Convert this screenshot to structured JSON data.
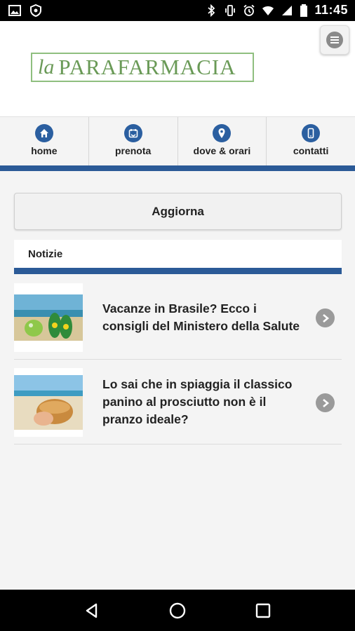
{
  "status_bar": {
    "time": "11:45",
    "left_icons": [
      "image-icon",
      "shield-icon"
    ],
    "right_icons": [
      "bluetooth-icon",
      "vibrate-icon",
      "alarm-icon",
      "wifi-icon",
      "signal-icon",
      "battery-icon"
    ]
  },
  "header": {
    "logo_prefix": "la",
    "logo_brand": "PARAFARMACIA",
    "menu_icon": "menu-icon"
  },
  "nav": {
    "items": [
      {
        "label": "home",
        "icon": "home-icon"
      },
      {
        "label": "prenota",
        "icon": "calendar-icon"
      },
      {
        "label": "dove & orari",
        "icon": "location-pin-icon"
      },
      {
        "label": "contatti",
        "icon": "phone-icon"
      }
    ]
  },
  "main": {
    "refresh_label": "Aggiorna",
    "section_title": "Notizie",
    "news": [
      {
        "title": "Vacanze in Brasile? Ecco i consigli del Ministero della Salute",
        "thumb": "beach-flipflops-thumbnail"
      },
      {
        "title": "Lo sai che in spiaggia il classico panino al prosciutto non è il pranzo ideale?",
        "thumb": "beach-sandwich-thumbnail"
      }
    ]
  },
  "system_nav": {
    "icons": [
      "back-icon",
      "home-circle-icon",
      "recents-icon"
    ]
  },
  "colors": {
    "accent_blue": "#2b5a97",
    "logo_green": "#6a9a57"
  }
}
